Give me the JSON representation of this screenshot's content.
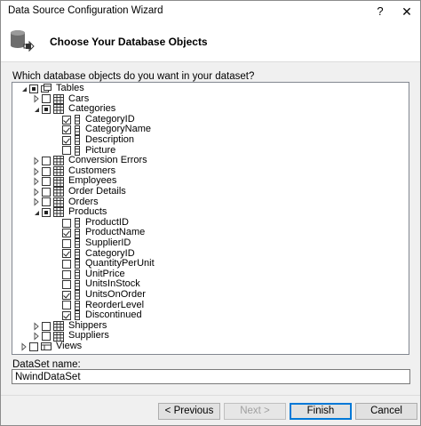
{
  "window": {
    "title": "Data Source Configuration Wizard",
    "help": "?",
    "close": "✕"
  },
  "header": {
    "title": "Choose Your Database Objects"
  },
  "question": "Which database objects do you want in your dataset?",
  "tree": [
    {
      "label": "Tables",
      "level": 0,
      "expander": "expanded",
      "check": "partial",
      "icon": "tables-icon"
    },
    {
      "label": "Cars",
      "level": 1,
      "expander": "collapsed",
      "check": "unchecked",
      "icon": "table-icon"
    },
    {
      "label": "Categories",
      "level": 1,
      "expander": "expanded",
      "check": "partial",
      "icon": "table-icon"
    },
    {
      "label": "CategoryID",
      "level": 2,
      "expander": "none",
      "check": "checked",
      "icon": "column-icon"
    },
    {
      "label": "CategoryName",
      "level": 2,
      "expander": "none",
      "check": "checked",
      "icon": "column-icon"
    },
    {
      "label": "Description",
      "level": 2,
      "expander": "none",
      "check": "checked",
      "icon": "column-icon"
    },
    {
      "label": "Picture",
      "level": 2,
      "expander": "none",
      "check": "unchecked",
      "icon": "column-icon"
    },
    {
      "label": "Conversion Errors",
      "level": 1,
      "expander": "collapsed",
      "check": "unchecked",
      "icon": "table-icon"
    },
    {
      "label": "Customers",
      "level": 1,
      "expander": "collapsed",
      "check": "unchecked",
      "icon": "table-icon"
    },
    {
      "label": "Employees",
      "level": 1,
      "expander": "collapsed",
      "check": "unchecked",
      "icon": "table-icon"
    },
    {
      "label": "Order Details",
      "level": 1,
      "expander": "collapsed",
      "check": "unchecked",
      "icon": "table-icon"
    },
    {
      "label": "Orders",
      "level": 1,
      "expander": "collapsed",
      "check": "unchecked",
      "icon": "table-icon"
    },
    {
      "label": "Products",
      "level": 1,
      "expander": "expanded",
      "check": "partial",
      "icon": "table-icon"
    },
    {
      "label": "ProductID",
      "level": 2,
      "expander": "none",
      "check": "unchecked",
      "icon": "column-icon"
    },
    {
      "label": "ProductName",
      "level": 2,
      "expander": "none",
      "check": "checked",
      "icon": "column-icon"
    },
    {
      "label": "SupplierID",
      "level": 2,
      "expander": "none",
      "check": "unchecked",
      "icon": "column-icon"
    },
    {
      "label": "CategoryID",
      "level": 2,
      "expander": "none",
      "check": "checked",
      "icon": "column-icon"
    },
    {
      "label": "QuantityPerUnit",
      "level": 2,
      "expander": "none",
      "check": "unchecked",
      "icon": "column-icon"
    },
    {
      "label": "UnitPrice",
      "level": 2,
      "expander": "none",
      "check": "unchecked",
      "icon": "column-icon"
    },
    {
      "label": "UnitsInStock",
      "level": 2,
      "expander": "none",
      "check": "unchecked",
      "icon": "column-icon"
    },
    {
      "label": "UnitsOnOrder",
      "level": 2,
      "expander": "none",
      "check": "checked",
      "icon": "column-icon"
    },
    {
      "label": "ReorderLevel",
      "level": 2,
      "expander": "none",
      "check": "unchecked",
      "icon": "column-icon"
    },
    {
      "label": "Discontinued",
      "level": 2,
      "expander": "none",
      "check": "checked",
      "icon": "column-icon"
    },
    {
      "label": "Shippers",
      "level": 1,
      "expander": "collapsed",
      "check": "unchecked",
      "icon": "table-icon"
    },
    {
      "label": "Suppliers",
      "level": 1,
      "expander": "collapsed",
      "check": "unchecked",
      "icon": "table-icon"
    },
    {
      "label": "Views",
      "level": 0,
      "expander": "collapsed",
      "check": "unchecked",
      "icon": "views-icon"
    }
  ],
  "dataset": {
    "label": "DataSet name:",
    "value": "NwindDataSet"
  },
  "buttons": {
    "previous": "< Previous",
    "next": "Next >",
    "finish": "Finish",
    "cancel": "Cancel"
  }
}
